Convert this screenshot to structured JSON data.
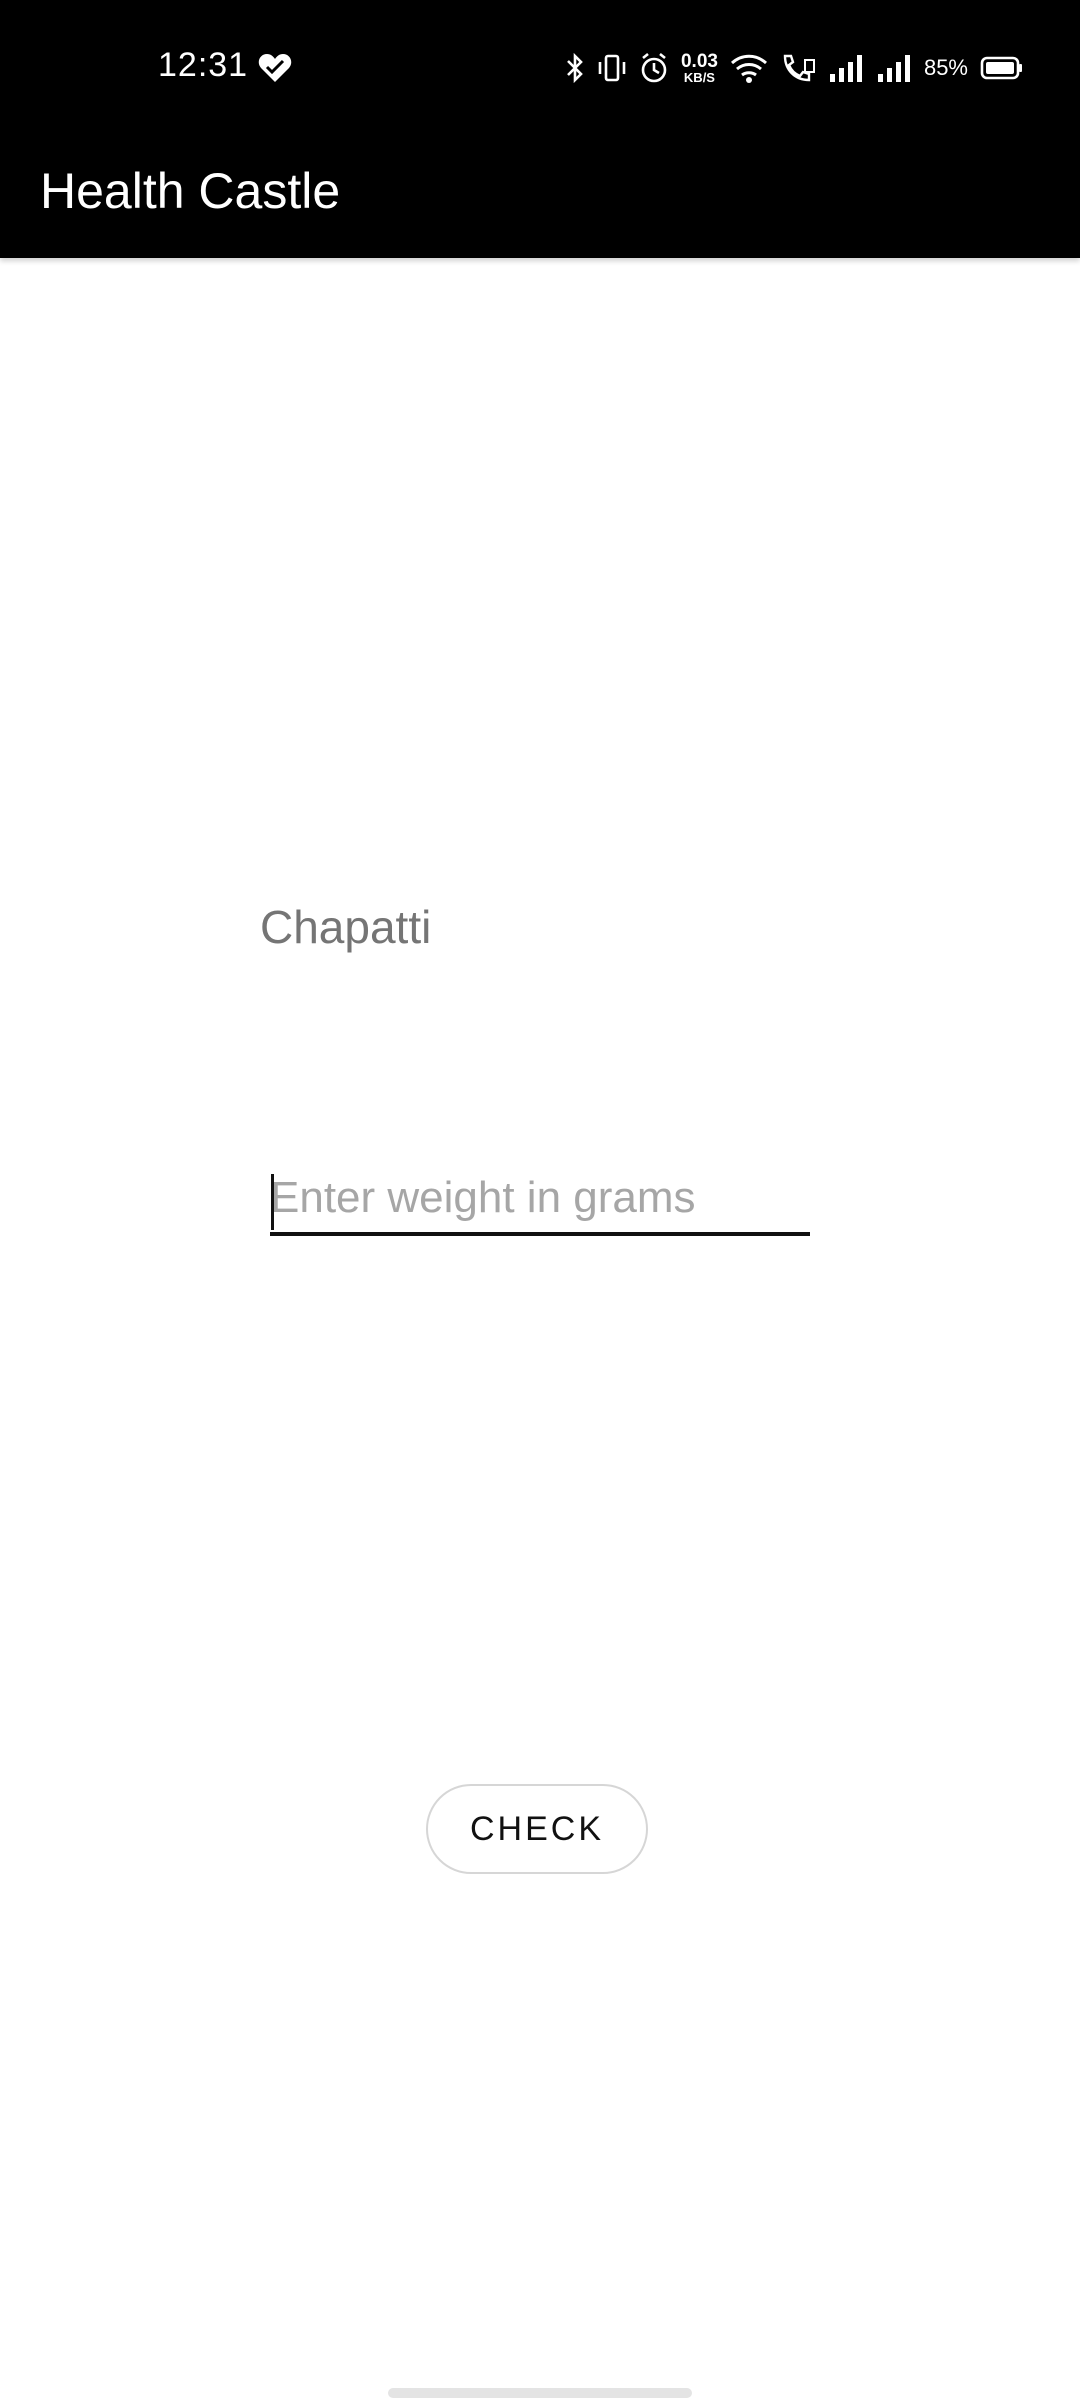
{
  "status_bar": {
    "time": "12:31",
    "net_speed_value": "0.03",
    "net_speed_unit": "KB/S",
    "battery_percent": "85%",
    "icons": [
      "heart-icon",
      "bluetooth-icon",
      "vibrate-icon",
      "alarm-icon",
      "wifi-icon",
      "volte-call-icon",
      "signal-icon",
      "signal-icon",
      "battery-icon"
    ]
  },
  "app_bar": {
    "title": "Health Castle",
    "background": "#000000"
  },
  "main": {
    "food_name": "Chapatti",
    "weight_input": {
      "placeholder": "Enter weight in grams",
      "value": ""
    },
    "check_button_label": "CHECK"
  },
  "colors": {
    "accent": "#000000",
    "label_gray": "#757575",
    "placeholder_gray": "#a6a6a6"
  }
}
